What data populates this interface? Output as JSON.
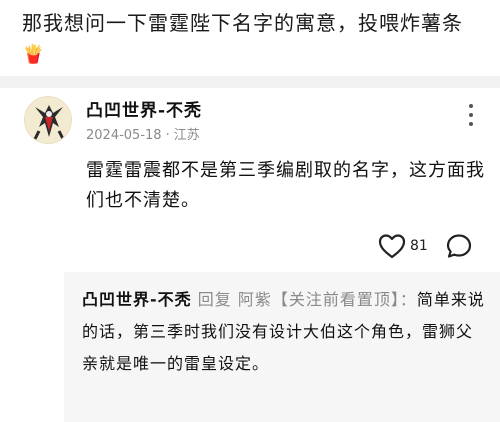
{
  "post": {
    "text": "那我想问一下雷霆陛下名字的寓意，投喂炸薯条",
    "emoji": "🍟"
  },
  "comment": {
    "username": "凸凹世界-不秃",
    "date": "2024-05-18",
    "separator": "·",
    "location": "江苏",
    "text": "雷霆雷震都不是第三季编剧取的名字，这方面我们也不清楚。",
    "like_count": "81"
  },
  "reply": {
    "author": "凸凹世界-不秃",
    "reply_word": "回复",
    "target": "阿紫【关注前看置顶】",
    "colon": "：",
    "text": "简单来说的话，第三季时我们没有设计大伯这个角色，雷狮父亲就是唯一的雷皇设定。"
  },
  "icons": {
    "like": "heart-outline-icon",
    "reply": "speech-bubble-icon",
    "more": "vertical-more-icon"
  },
  "colors": {
    "divider": "#f2f2f2",
    "reply_bg": "#f6f6f6",
    "meta_text": "#8a8a8a"
  }
}
